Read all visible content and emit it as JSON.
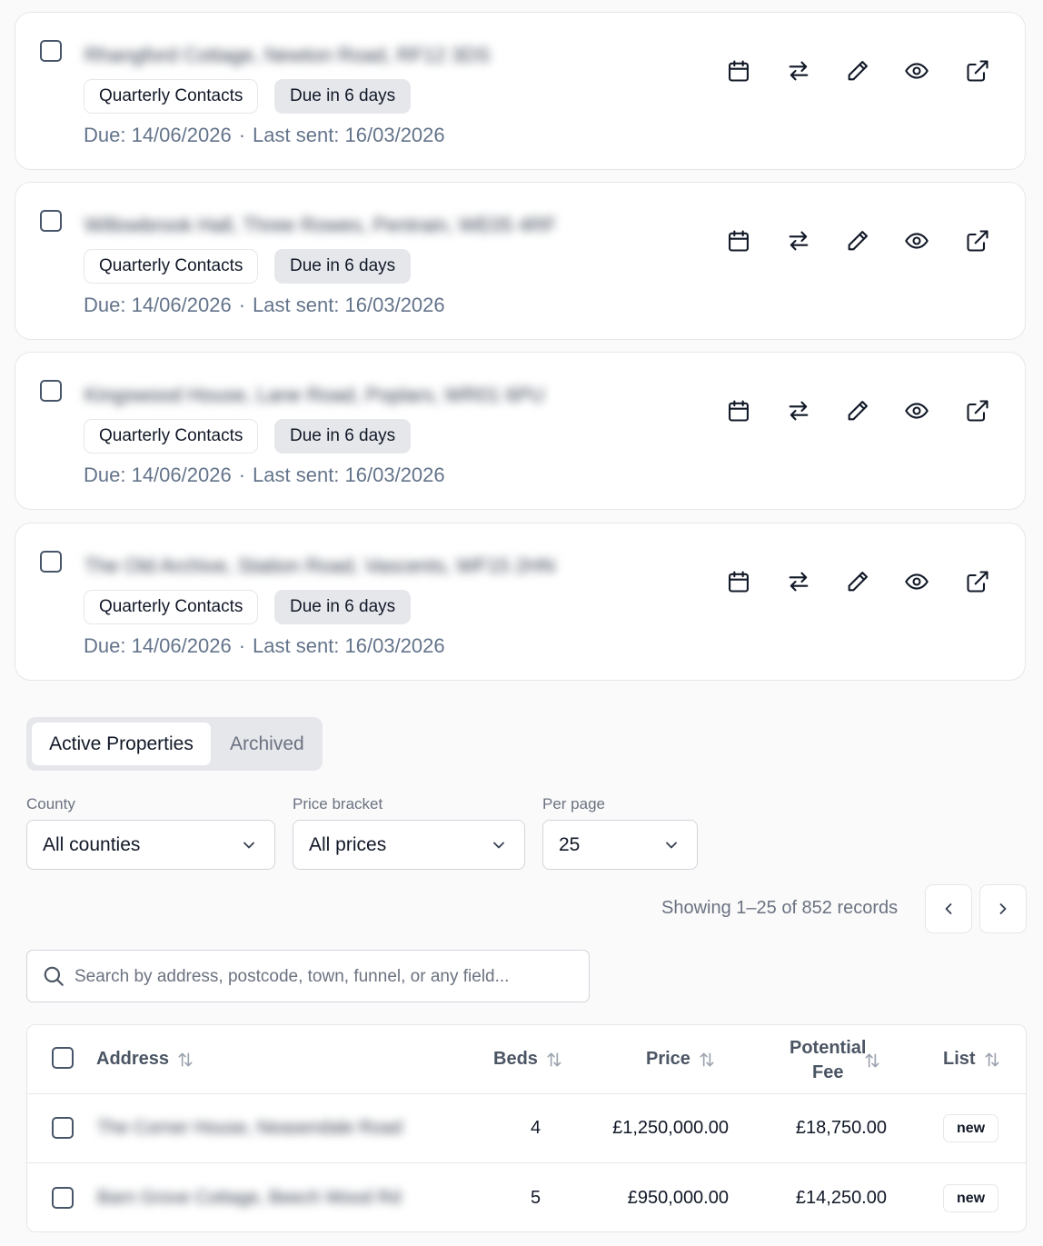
{
  "reminders": [
    {
      "address": "Rhangford Cottage, Newton Road, RF12 3DS",
      "contact_type": "Quarterly Contacts",
      "due_badge": "Due in 6 days",
      "due": "Due: 14/06/2026",
      "last_sent": "Last sent: 16/03/2026"
    },
    {
      "address": "Willowbrook Hall, Three Rowes, Pentrain, WE05 4RF",
      "contact_type": "Quarterly Contacts",
      "due_badge": "Due in 6 days",
      "due": "Due: 14/06/2026",
      "last_sent": "Last sent: 16/03/2026"
    },
    {
      "address": "Kingswood House, Lane Road, Poplars, WR01 6PU",
      "contact_type": "Quarterly Contacts",
      "due_badge": "Due in 6 days",
      "due": "Due: 14/06/2026",
      "last_sent": "Last sent: 16/03/2026"
    },
    {
      "address": "The Old Archive, Station Road, Vascents, WF15 2HN",
      "contact_type": "Quarterly Contacts",
      "due_badge": "Due in 6 days",
      "due": "Due: 14/06/2026",
      "last_sent": "Last sent: 16/03/2026"
    }
  ],
  "separator": "·",
  "actions": [
    "calendar-icon",
    "swap-arrows-icon",
    "pencil-icon",
    "eye-icon",
    "external-link-icon"
  ],
  "tabs": {
    "active": "Active Properties",
    "inactive": "Archived"
  },
  "filters": {
    "county": {
      "label": "County",
      "value": "All counties"
    },
    "price": {
      "label": "Price bracket",
      "value": "All prices"
    },
    "per_page": {
      "label": "Per page",
      "value": "25"
    }
  },
  "pagination": {
    "showing": "Showing 1–25 of 852 records"
  },
  "search": {
    "placeholder": "Search by address, postcode, town, funnel, or any field..."
  },
  "table": {
    "columns": {
      "address": "Address",
      "beds": "Beds",
      "price": "Price",
      "fee_line1": "Potential",
      "fee_line2": "Fee",
      "list": "List"
    },
    "rows": [
      {
        "address": "The Corner House, Neasendale Road",
        "beds": "4",
        "price": "£1,250,000.00",
        "fee": "£18,750.00",
        "list": "new"
      },
      {
        "address": "Barn Grove Cottage, Beech Wood Rd",
        "beds": "5",
        "price": "£950,000.00",
        "fee": "£14,250.00",
        "list": "new"
      }
    ]
  },
  "colors": {
    "text": "#111827",
    "muted": "#64748b",
    "border": "#e5e7eb",
    "pill": "#e5e7eb",
    "background": "#fafafa"
  }
}
